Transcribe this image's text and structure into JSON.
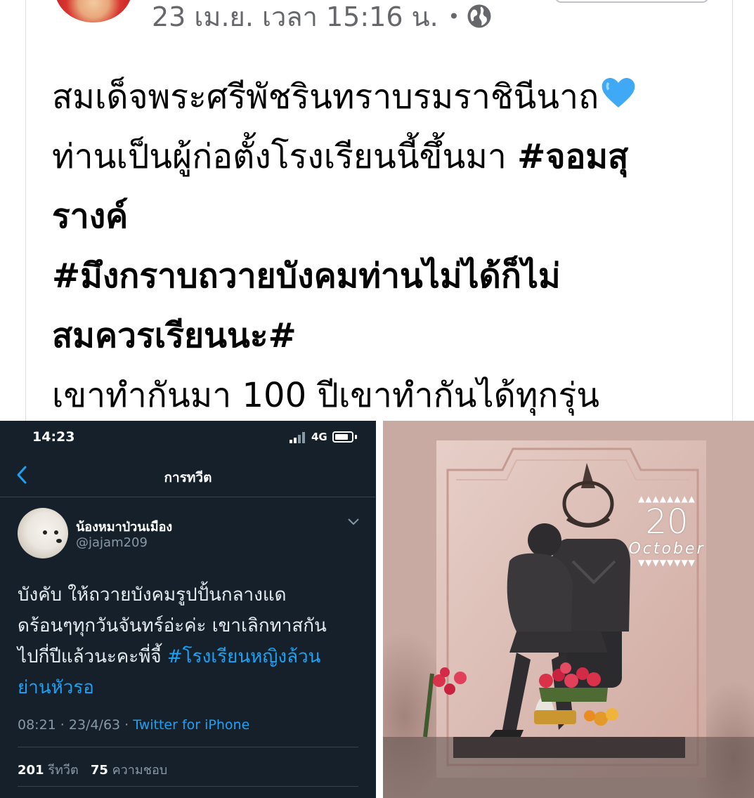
{
  "post": {
    "meta": {
      "date_time": "23 เม.ย. เวลา 15:16 น.",
      "separator": "•",
      "audience_icon": "globe-icon"
    },
    "text_lines": [
      "สมเด็จพระศรีพัชรินทราบรมราชินีนาถ",
      "ท่านเป็นผู้ก่อตั้งโรงเรียนนี้ขึ้นมา ",
      "#จอมสุ",
      "รางค์",
      "#มึงกราบถวายบังคมท่านไม่ได้ก็ไม่",
      "สมควรเรียนนะ#",
      "เขาทำกันมา 100 ปีเขาทำกันได้ทุกรุ่น"
    ],
    "heart_emoji": "blue-heart-icon"
  },
  "tweet": {
    "status": {
      "time": "14:23",
      "network": "4G"
    },
    "nav_title": "การทวีต",
    "author_name": "น้องหมาป่วนเมือง",
    "author_handle": "@jajam209",
    "body_lines": [
      "บังคับ ให้ถวายบังคมรูปปั้นกลางแด",
      "ดร้อนๆทุกวันจันทร์อ่ะค่ะ เขาเลิกทาสกัน",
      "ไปกี่ปีแล้วนะคะพี่จี้ ",
      "#โรงเรียนหญิงล้วน",
      "ย่านหัวรอ"
    ],
    "timestamp": "08:21 · 23/4/63 · ",
    "client": "Twitter for iPhone",
    "retweets_count": "201",
    "retweets_label": "รีทวีต",
    "likes_count": "75",
    "likes_label": "ความชอบ"
  },
  "photo": {
    "date_day": "20",
    "date_month": "October",
    "tri_top": "▲▲▲▲▲▲▲▲",
    "tri_bottom": "▼▼▼▼▼▼▼▼"
  },
  "colors": {
    "twitter_bg": "#15202b",
    "twitter_link": "#1da1f2",
    "fb_meta": "#65676b"
  }
}
